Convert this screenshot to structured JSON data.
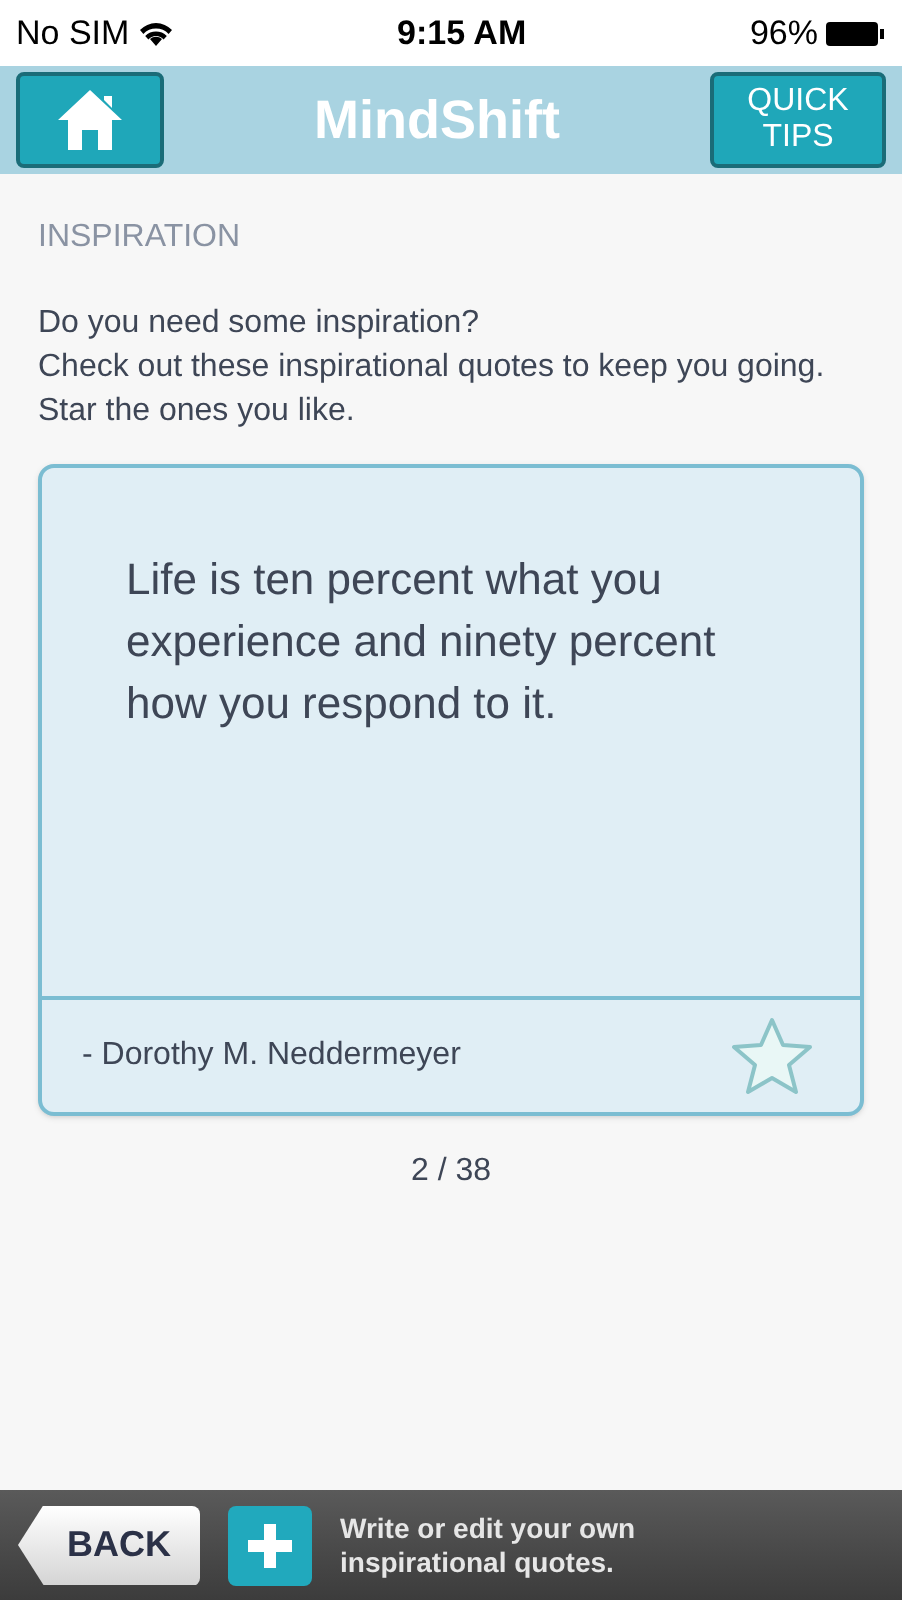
{
  "status_bar": {
    "carrier": "No SIM",
    "time": "9:15 AM",
    "battery": "96%"
  },
  "header": {
    "title": "MindShift",
    "quick_tips": "QUICK TIPS"
  },
  "section_title": "INSPIRATION",
  "intro": [
    "Do you need some inspiration?",
    "Check out these inspirational quotes to keep you going. Star the ones you like."
  ],
  "quote": {
    "text": "Life is ten percent what you experience and ninety percent how you respond to it.",
    "author": "- Dorothy M. Neddermeyer",
    "starred": false
  },
  "counter": "2 / 38",
  "bottom_bar": {
    "back": "BACK",
    "add_label": "Write or edit your own inspirational quotes."
  }
}
